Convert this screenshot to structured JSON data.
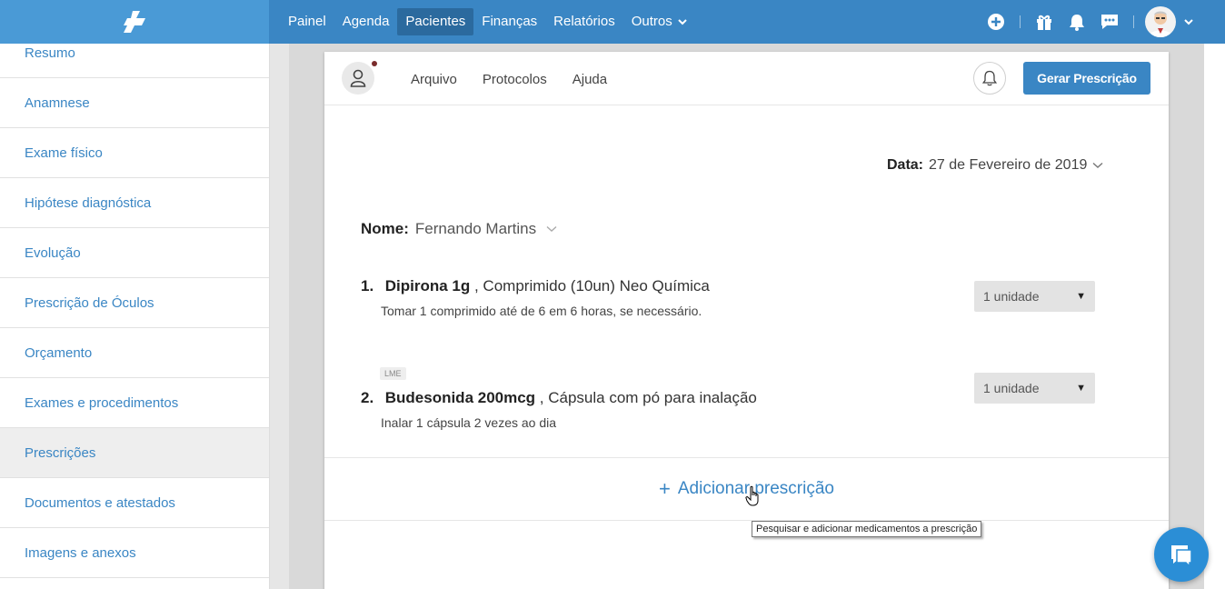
{
  "topbar": {
    "nav": [
      {
        "label": "Painel",
        "active": false
      },
      {
        "label": "Agenda",
        "active": false
      },
      {
        "label": "Pacientes",
        "active": true
      },
      {
        "label": "Finanças",
        "active": false
      },
      {
        "label": "Relatórios",
        "active": false
      },
      {
        "label": "Outros",
        "active": false
      }
    ],
    "icons": [
      "plus-circle-icon",
      "gift-icon",
      "bell-icon",
      "chat-icon",
      "avatar",
      "chevron-down-icon"
    ],
    "accent": "#3a86c4"
  },
  "sidebar": {
    "items": [
      {
        "label": "Resumo"
      },
      {
        "label": "Anamnese"
      },
      {
        "label": "Exame físico"
      },
      {
        "label": "Hipótese diagnóstica"
      },
      {
        "label": "Evolução"
      },
      {
        "label": "Prescrição de Óculos"
      },
      {
        "label": "Orçamento"
      },
      {
        "label": "Exames e procedimentos"
      },
      {
        "label": "Prescrições",
        "active": true
      },
      {
        "label": "Documentos e atestados"
      },
      {
        "label": "Imagens e anexos"
      }
    ]
  },
  "document": {
    "menu": {
      "file": "Arquivo",
      "protocols": "Protocolos",
      "help": "Ajuda"
    },
    "generate_button": "Gerar Prescrição",
    "date_label": "Data:",
    "date_value": "27 de Fevereiro de 2019",
    "name_label": "Nome:",
    "name_value": "Fernando Martins",
    "prescriptions": [
      {
        "number": "1.",
        "drug": "Dipirona 1g",
        "detail": ", Comprimido (10un) Neo Química",
        "instructions": "Tomar 1 comprimido até de 6 em 6 horas, se necessário.",
        "quantity": "1 unidade",
        "badge": ""
      },
      {
        "number": "2.",
        "drug": "Budesonida 200mcg",
        "detail": ", Cápsula com pó para inalação",
        "instructions": "Inalar 1 cápsula 2 vezes ao dia",
        "quantity": "1 unidade",
        "badge": "LME"
      }
    ],
    "add_label": "Adicionar prescrição",
    "add_tooltip": "Pesquisar e adicionar medicamentos a prescrição"
  }
}
